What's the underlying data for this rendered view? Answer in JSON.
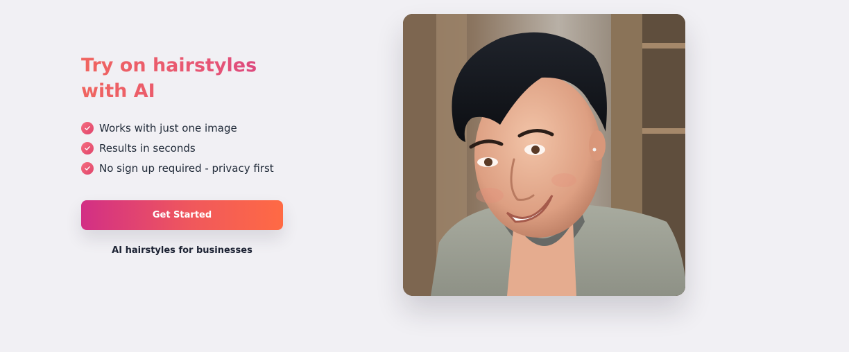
{
  "hero": {
    "title": "Try on hairstyles with AI",
    "features": [
      "Works with just one image",
      "Results in seconds",
      "No sign up required - privacy first"
    ],
    "cta_label": "Get Started",
    "business_link": "AI hairstyles for businesses",
    "photo_icon": "portrait-photo"
  },
  "colors": {
    "background": "#f1f0f4",
    "title_gradient_start": "#f0655f",
    "title_gradient_end": "#d23c86",
    "cta_gradient_start": "#d22f85",
    "cta_gradient_end": "#ff6a44",
    "check_color": "#e0446c",
    "text": "#1f2937"
  }
}
